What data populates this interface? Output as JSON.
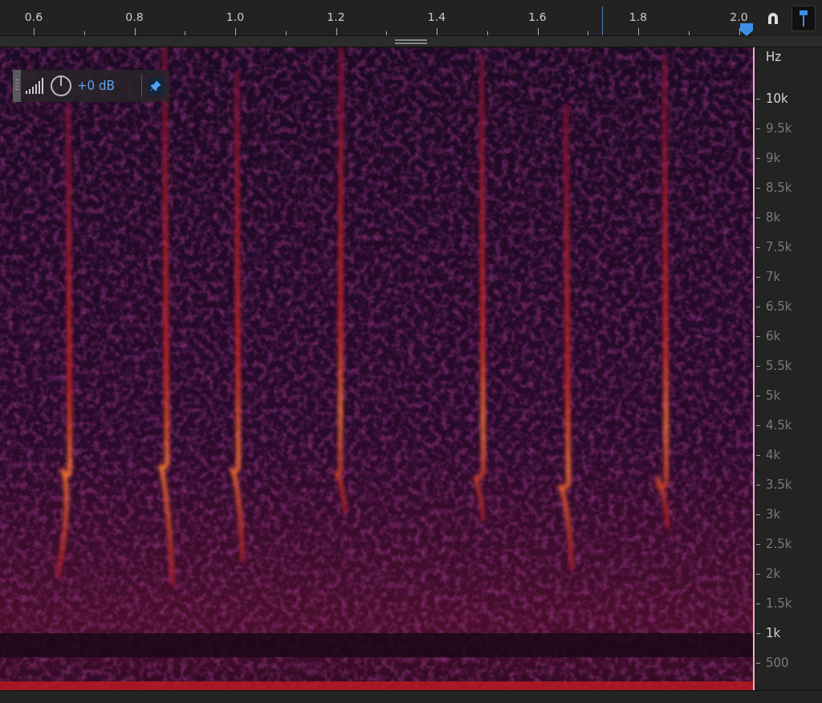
{
  "ruler": {
    "labels": [
      "0.6",
      "0.8",
      "1.0",
      "1.2",
      "1.4",
      "1.6",
      "1.8",
      "2.0"
    ]
  },
  "toolbar": {
    "snap_on": false,
    "pin_selected": true
  },
  "hud": {
    "gain": "+0 dB",
    "pinned": true
  },
  "frequency_axis": {
    "unit": "Hz",
    "labels": [
      {
        "text": "10k",
        "emphasized": true
      },
      {
        "text": "9.5k",
        "emphasized": false
      },
      {
        "text": "9k",
        "emphasized": false
      },
      {
        "text": "8.5k",
        "emphasized": false
      },
      {
        "text": "8k",
        "emphasized": false
      },
      {
        "text": "7.5k",
        "emphasized": false
      },
      {
        "text": "7k",
        "emphasized": false
      },
      {
        "text": "6.5k",
        "emphasized": false
      },
      {
        "text": "6k",
        "emphasized": false
      },
      {
        "text": "5.5k",
        "emphasized": false
      },
      {
        "text": "5k",
        "emphasized": false
      },
      {
        "text": "4.5k",
        "emphasized": false
      },
      {
        "text": "4k",
        "emphasized": false
      },
      {
        "text": "3.5k",
        "emphasized": false
      },
      {
        "text": "3k",
        "emphasized": false
      },
      {
        "text": "2.5k",
        "emphasized": false
      },
      {
        "text": "2k",
        "emphasized": false
      },
      {
        "text": "1.5k",
        "emphasized": false
      },
      {
        "text": "1k",
        "emphasized": true
      },
      {
        "text": "500",
        "emphasized": false
      }
    ]
  }
}
